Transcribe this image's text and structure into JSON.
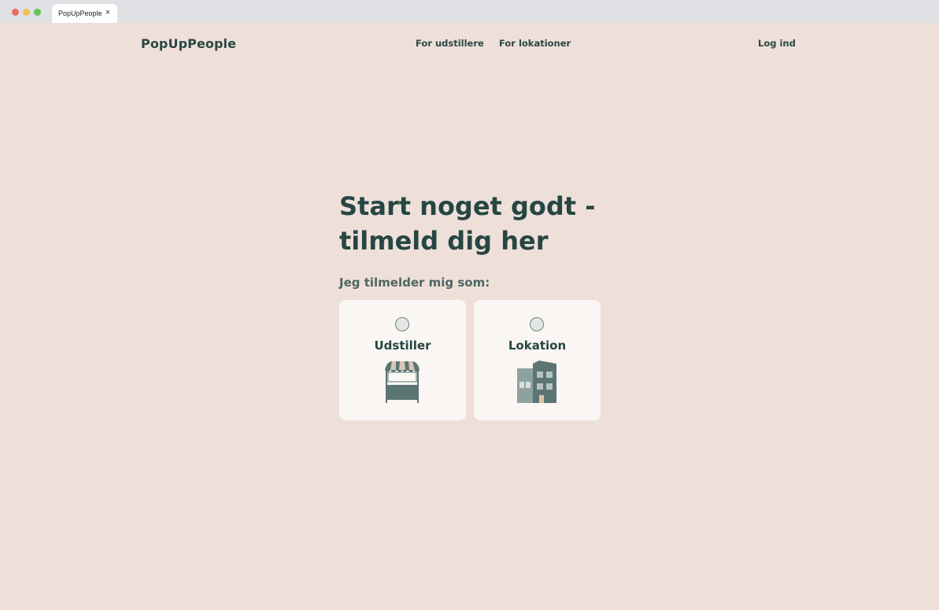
{
  "browser": {
    "tab_title": "PopUpPeople",
    "tab_close": "×"
  },
  "nav": {
    "logo": "PopUpPeople",
    "links": [
      "For udstillere",
      "For lokationer"
    ],
    "login": "Log ind"
  },
  "hero": {
    "headline": "Start noget godt - tilmeld dig her",
    "subline": "Jeg tilmelder mig som:"
  },
  "options": [
    {
      "label": "Udstiller",
      "icon": "market-stall-icon",
      "selected": false
    },
    {
      "label": "Lokation",
      "icon": "building-icon",
      "selected": false
    }
  ],
  "colors": {
    "background": "#eee0d9",
    "card": "#faf6f4",
    "text": "#274643",
    "icon_primary": "#5a7572",
    "icon_secondary": "#8fa19f"
  }
}
